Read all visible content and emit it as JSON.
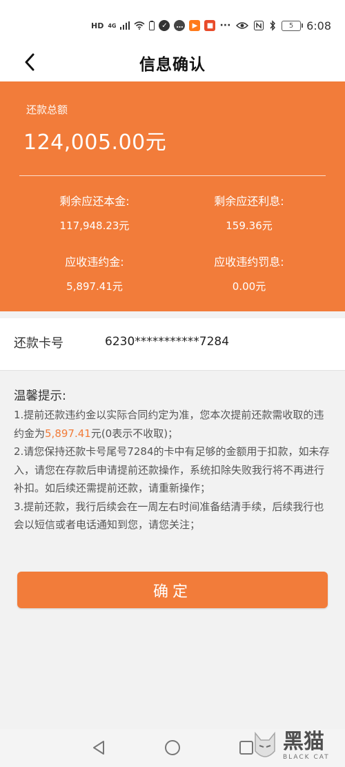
{
  "status_bar": {
    "network": "HD",
    "signal": "4G",
    "battery_level": "5",
    "time": "6:08"
  },
  "header": {
    "title": "信息确认"
  },
  "summary": {
    "total_label": "还款总额",
    "total_value": "124,005.00元",
    "metrics": [
      {
        "label": "剩余应还本金:",
        "value": "117,948.23元"
      },
      {
        "label": "剩余应还利息:",
        "value": "159.36元"
      },
      {
        "label": "应收违约金:",
        "value": "5,897.41元"
      },
      {
        "label": "应收违约罚息:",
        "value": "0.00元"
      }
    ]
  },
  "card": {
    "label": "还款卡号",
    "number": "6230***********7284"
  },
  "tips": {
    "title": "温馨提示:",
    "line1_pre": "1.提前还款违约金以实际合同约定为准，您本次提前还款需收取的违约金为",
    "line1_amount": "5,897.41",
    "line1_post": "元(0表示不收取)；",
    "line2": "2.请您保持还款卡号尾号7284的卡中有足够的金额用于扣款，如未存入，请您在存款后申请提前还款操作，系统扣除失败我行将不再进行补扣。如后续还需提前还款，请重新操作；",
    "line3": "3.提前还款，我行后续会在一周左右时间准备结清手续，后续我行也会以短信或者电话通知到您，请您关注；"
  },
  "confirm_button": {
    "label": "确定"
  },
  "watermark": {
    "cn": "黑猫",
    "en": "BLACK CAT"
  },
  "colors": {
    "accent": "#f27c3a",
    "background": "#f2f2f2"
  }
}
